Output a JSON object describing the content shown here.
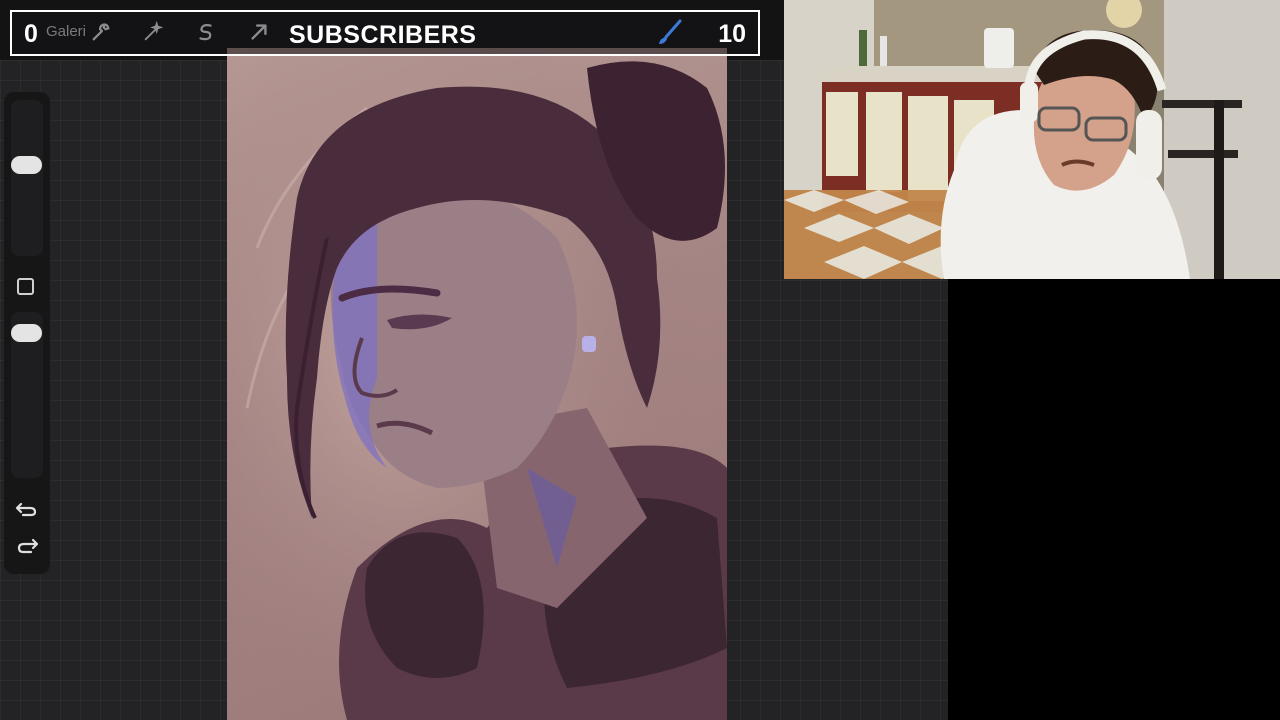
{
  "app": {
    "gallery_label": "Galeri"
  },
  "overlay": {
    "left_count": "0",
    "label": "SUBSCRIBERS",
    "right_count": "10"
  },
  "toolbar": {
    "tools": [
      "wrench-icon",
      "magic-wand-icon",
      "selection-icon",
      "transform-arrow-icon"
    ],
    "active_tool": "brush-icon",
    "side_buttons": [
      "undo-icon",
      "redo-icon"
    ]
  },
  "colors": {
    "workspace": "#232325",
    "canvas": "#a58583",
    "accent_brush": "#3d7bd9",
    "overlay_border": "#ffffff"
  },
  "webcam": {
    "present": true
  }
}
